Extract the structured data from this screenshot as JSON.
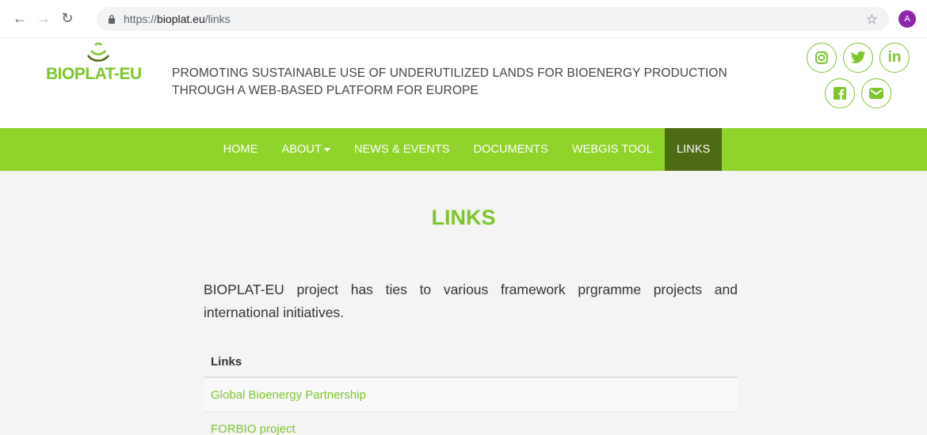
{
  "browser": {
    "url_secure": "https://",
    "url_host": "bioplat.eu",
    "url_path": "/links",
    "profile_initial": "A"
  },
  "header": {
    "logo_text": "BIOPLAT-EU",
    "tagline_line1": "PROMOTING SUSTAINABLE USE OF UNDERUTILIZED LANDS FOR BIOENERGY PRODUCTION",
    "tagline_line2": "THROUGH A WEB-BASED PLATFORM FOR EUROPE",
    "social": [
      {
        "name": "instagram-icon"
      },
      {
        "name": "twitter-icon"
      },
      {
        "name": "linkedin-icon",
        "text": "in"
      },
      {
        "name": "facebook-icon"
      },
      {
        "name": "email-icon"
      }
    ]
  },
  "nav": {
    "items": [
      {
        "label": "HOME"
      },
      {
        "label": "ABOUT"
      },
      {
        "label": "NEWS & EVENTS"
      },
      {
        "label": "DOCUMENTS"
      },
      {
        "label": "WEBGIS TOOL"
      },
      {
        "label": "LINKS"
      }
    ],
    "active": "LINKS"
  },
  "main": {
    "title": "LINKS",
    "intro": "BIOPLAT-EU project has ties to various framework prgramme projects and international initiatives.",
    "table_header": "Links",
    "links": [
      {
        "label": "Global Bioenergy Partnership"
      },
      {
        "label": "FORBIO project"
      }
    ]
  },
  "colors": {
    "brand_green": "#7cc62c",
    "nav_green": "#8ed42a",
    "nav_active": "#4d6b14"
  }
}
